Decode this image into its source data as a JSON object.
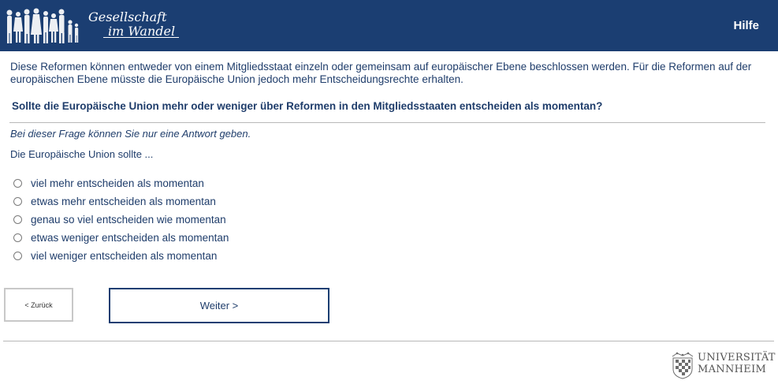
{
  "header": {
    "logo_line1": "Gesellschaft",
    "logo_line2": "im Wandel",
    "help_label": "Hilfe",
    "background_color": "#1b3e72"
  },
  "intro_text": "Diese Reformen können entweder von einem Mitgliedsstaat einzeln oder gemeinsam auf europäischer Ebene beschlossen werden. Für die Reformen auf der europäischen Ebene müsste die Europäische Union jedoch mehr Entscheidungsrechte erhalten.",
  "question": "Sollte die Europäische Union mehr oder weniger über Reformen in den Mitgliedsstaaten entscheiden als momentan?",
  "hint": "Bei dieser Frage können Sie nur eine Antwort geben.",
  "stem": "Die Europäische Union sollte ...",
  "options": [
    {
      "label": "viel mehr entscheiden als momentan",
      "selected": false
    },
    {
      "label": "etwas mehr entscheiden als momentan",
      "selected": false
    },
    {
      "label": "genau so viel entscheiden wie momentan",
      "selected": false
    },
    {
      "label": "etwas weniger entscheiden als momentan",
      "selected": false
    },
    {
      "label": "viel weniger entscheiden als momentan",
      "selected": false
    }
  ],
  "nav": {
    "back_label": "< Zurück",
    "next_label": "Weiter >"
  },
  "footer": {
    "university_line1": "UNIVERSITÄT",
    "university_line2": "MANNHEIM"
  }
}
